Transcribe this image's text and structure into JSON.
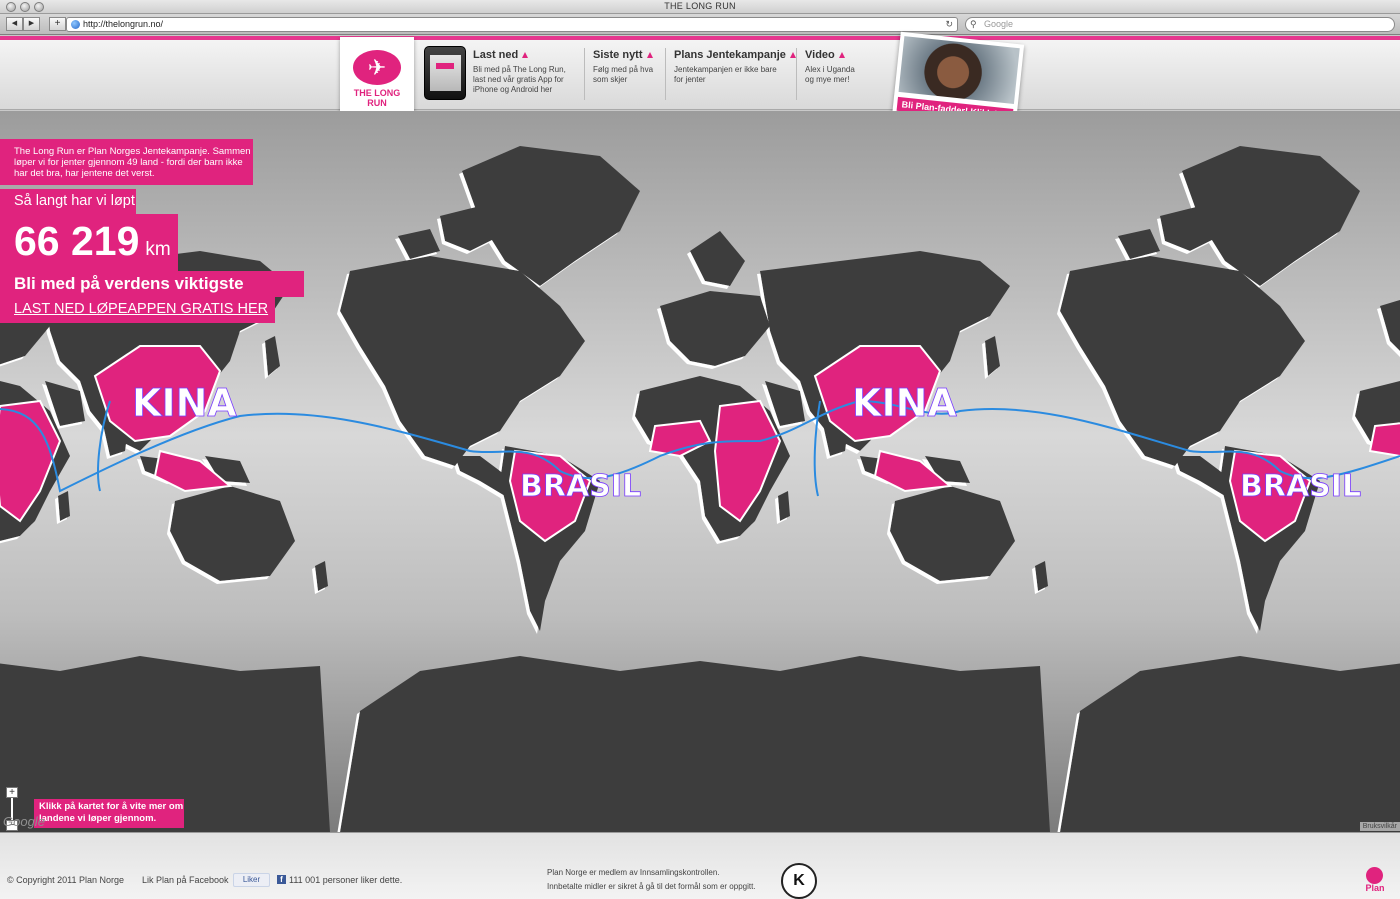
{
  "browser": {
    "title": "THE LONG RUN",
    "back": "◀",
    "forward": "▶",
    "add_tab": "+",
    "url": "http://thelongrun.no/",
    "reload": "↻",
    "search_placeholder": "Google"
  },
  "header": {
    "logo_text_line1": "THE LONG",
    "logo_text_line2": "RUN",
    "nav": [
      {
        "title": "Last ned",
        "desc": "Bli med på The Long Run, last ned vår gratis App for iPhone og Android her"
      },
      {
        "title": "Siste nytt",
        "desc": "Følg med på hva som skjer"
      },
      {
        "title": "Plans Jentekampanje",
        "desc": "Jentekampanjen er ikke bare for jenter"
      },
      {
        "title": "Video",
        "desc": "Alex i Uganda og mye mer!"
      }
    ],
    "sponsor_cta": "Bli Plan-fadder! Klikk her"
  },
  "map": {
    "intro": "The Long Run er Plan Norges Jentekampanje. Sammen løper vi for jenter gjennom 49 land - fordi der barn ikke har det bra, har jentene det verst.",
    "distance_label": "Så langt har vi løpt",
    "distance_value": "66 219",
    "distance_unit": "km",
    "join_text": "Bli med på verdens viktigste løpetur",
    "download_link": "LAST NED LØPEAPPEN GRATIS HER",
    "hint": "Klikk på kartet for å vite mer om landene vi løper gjennom.",
    "zoom_in": "+",
    "zoom_out": "−",
    "google": "Google",
    "terms": "Bruksvilkår",
    "country_labels": [
      "KINA",
      "BRASIL",
      "KINA",
      "BRASIL"
    ]
  },
  "footer": {
    "copyright": "© Copyright 2011 Plan Norge",
    "like_text": "Lik Plan på Facebook",
    "like_button": "Liker",
    "like_count": "111 001 personer liker dette.",
    "member_line1": "Plan Norge er medlem av Innsamlingskontrollen.",
    "member_line2": "Innbetalte midler er sikret å gå til det formål som er oppgitt.",
    "seal_letter": "K",
    "plan_logo": "Plan"
  },
  "colors": {
    "brand_pink": "#e0237e",
    "land": "#3d3d3d",
    "route": "#2b8be0"
  }
}
